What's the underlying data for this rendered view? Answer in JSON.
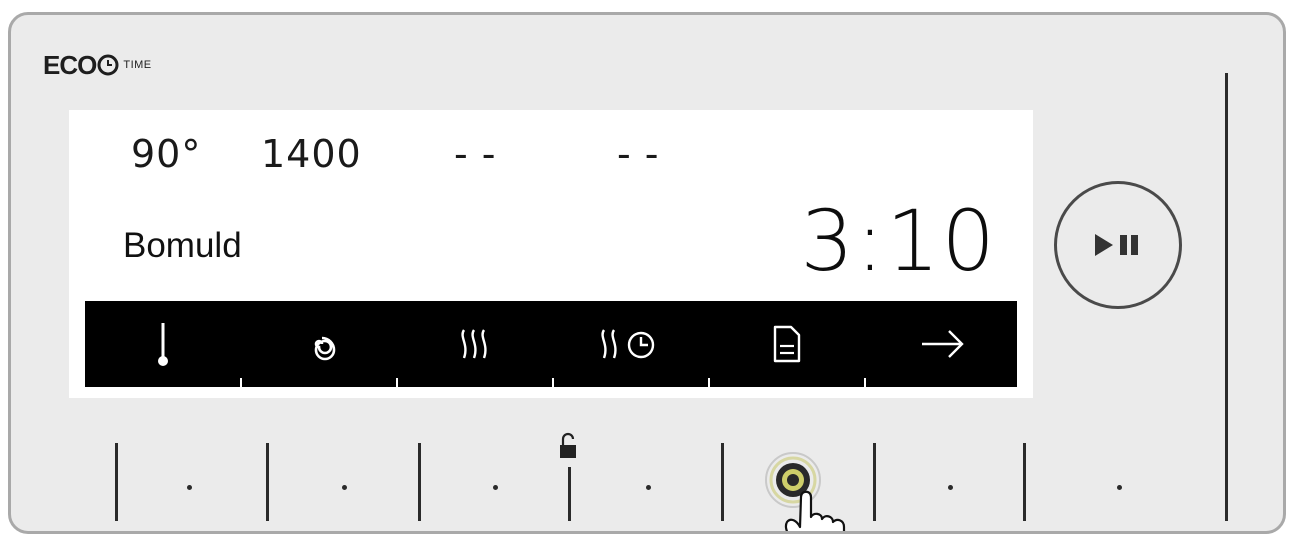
{
  "brand": {
    "eco": "ECO",
    "time": "TIME"
  },
  "display": {
    "temperature": "90°",
    "spin": "1400",
    "option_a": "- -",
    "option_b": "- -",
    "program": "Bomuld",
    "time_remaining": "3:10"
  },
  "icon_bar": {
    "items": [
      {
        "icon": "thermometer-icon"
      },
      {
        "icon": "spin-icon"
      },
      {
        "icon": "steam-icon"
      },
      {
        "icon": "steam-timer-icon"
      },
      {
        "icon": "document-icon"
      },
      {
        "icon": "arrow-right-icon"
      }
    ]
  },
  "controls": {
    "play_pause_icon": "play-pause-icon",
    "lock_icon": "lock-icon",
    "active_icon": "touch-icon",
    "accent_color": "#cfcf6a"
  }
}
